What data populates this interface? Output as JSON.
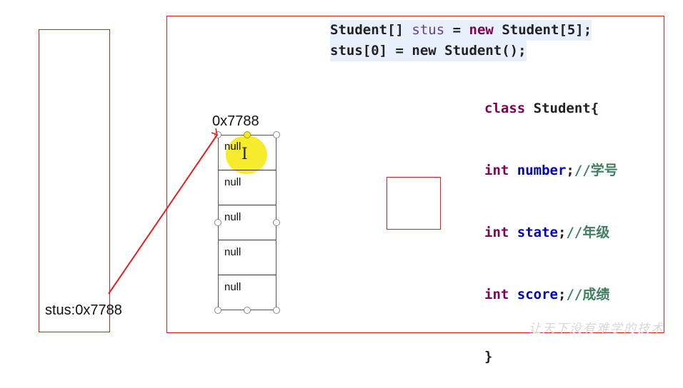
{
  "code": {
    "line1": {
      "type": "Student[]",
      "var": "stus",
      "eq": "=",
      "new": "new",
      "rest": "Student[5];"
    },
    "line2": {
      "text": "stus[0] = new Student();"
    },
    "class_decl": {
      "class_kw": "class",
      "name": "Student{"
    },
    "fields": [
      {
        "type": "int",
        "name": "number",
        "sep": ";",
        "comment": "//学号"
      },
      {
        "type": "int",
        "name": "state",
        "sep": ";",
        "comment": "//年级"
      },
      {
        "type": "int",
        "name": "score",
        "sep": ";",
        "comment": "//成绩"
      }
    ],
    "close_brace": "}"
  },
  "stack": {
    "label": "stus:0x7788"
  },
  "heap": {
    "address": "0x7788",
    "cells": [
      "null",
      "null",
      "null",
      "null",
      "null"
    ]
  },
  "cursor_glyph": "I",
  "watermark": "让天下没有难学的技术",
  "colors": {
    "box_border": "#e02020",
    "arrow": "#e02020",
    "highlight": "#f5ea1a"
  }
}
